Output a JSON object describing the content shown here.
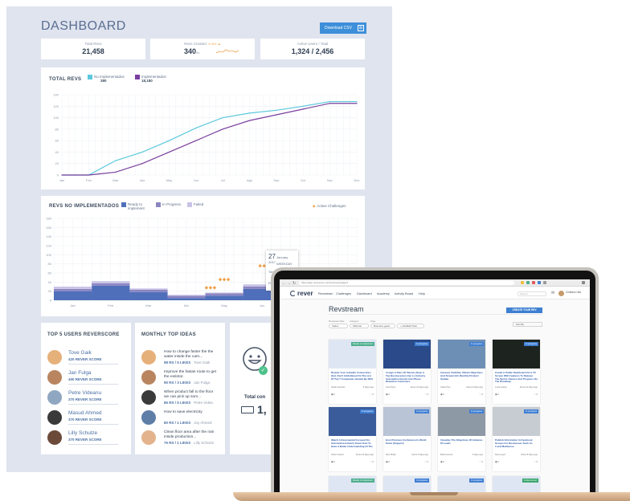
{
  "dashboard": {
    "title": "DASHBOARD",
    "download_label": "Download CSV",
    "kpis": [
      {
        "label": "Total Revs",
        "value": "21,458",
        "unit": ""
      },
      {
        "label": "Revs Created",
        "value": "340",
        "unit": "/m",
        "change": "+0.5%"
      },
      {
        "label": "Active Users / Total",
        "value": "1,324 / 2,456",
        "unit": ""
      }
    ],
    "total_revs": {
      "title": "TOTAL REVS",
      "legend": [
        {
          "label": "No Implementados",
          "value": "380",
          "color": "#5cc8dc"
        },
        {
          "label": "Implementados",
          "value": "18,180",
          "color": "#7a3f9e"
        }
      ]
    },
    "revs_no_impl": {
      "title": "REVS NO IMPLEMENTADOS",
      "legend": [
        {
          "label": "Ready to implement",
          "color": "#4f6fba"
        },
        {
          "label": "In Progress",
          "color": "#8b85c2"
        },
        {
          "label": "Failed",
          "color": "#c9c3e6"
        }
      ],
      "challenge_label": "Active Challenges",
      "tooltip": {
        "date": "27",
        "date_label": "January 2017",
        "weekday": "WEEKDAY",
        "rows": [
          {
            "label": "Total",
            "value": "120"
          },
          {
            "label": "Ready"
          },
          {
            "label": "In Pr"
          }
        ]
      }
    },
    "top_users": {
      "title": "TOP 5 USERS REVERSCORE",
      "users": [
        {
          "name": "Tove Gaik",
          "score": "420 REVER SCORE",
          "avatar_color": "#e6b07a"
        },
        {
          "name": "Jan Fulga",
          "score": "400 REVER SCORE",
          "avatar_color": "#b98560"
        },
        {
          "name": "Petre Videanu",
          "score": "370 REVER SCORE",
          "avatar_color": "#8fa7c0"
        },
        {
          "name": "Masud Ahmed",
          "score": "370 REVER SCORE",
          "avatar_color": "#3a3a3a"
        },
        {
          "name": "Lilly Schulze",
          "score": "370 REVER SCORE",
          "avatar_color": "#6b4a3a"
        }
      ]
    },
    "top_ideas": {
      "title": "MONTHLY TOP IDEAS",
      "ideas": [
        {
          "text": "How to change faster the the water inside the cam...",
          "stats": "98 RS / 5 LIKES",
          "author": "Tove Gaik",
          "avatar_color": "#e6b07a"
        },
        {
          "text": "Improve the fastas route to get the extintor.",
          "stats": "90 RS / 3 LIKES",
          "author": "Jan Fulga",
          "avatar_color": "#b98560"
        },
        {
          "text": "When product fall to the floor we can pick up som...",
          "stats": "85 RS / 5 LIKES",
          "author": "Petre Videa",
          "avatar_color": "#3a3a3a"
        },
        {
          "text": "How to save electricity",
          "stats": "80 RS / 1 LIKES",
          "author": "Joy Ahmed",
          "avatar_color": "#5e7ea8"
        },
        {
          "text": "Clean floor area after the rain inside production...",
          "stats": "75 RS / 1 LIKES",
          "author": "Lilly Schulze",
          "avatar_color": "#e2b38c"
        }
      ]
    },
    "partial_card": {
      "label": "Total con",
      "value": "1,",
      "icon": "smiley-icon"
    }
  },
  "chart_data": [
    {
      "type": "line",
      "title": "TOTAL REVS",
      "x": [
        "Jan",
        "Feb",
        "Mar",
        "Abr",
        "May",
        "Jun",
        "Jul",
        "Ago",
        "Sep",
        "Oct",
        "Nov",
        "Dec"
      ],
      "ylim": [
        0,
        140
      ],
      "yticks": [
        0,
        20,
        40,
        60,
        80,
        100,
        120,
        140
      ],
      "grid": true,
      "series": [
        {
          "name": "No Implementados",
          "color": "#5cc8dc",
          "values": [
            0,
            0,
            25,
            40,
            60,
            82,
            100,
            108,
            113,
            120,
            128,
            128
          ]
        },
        {
          "name": "Implementados",
          "color": "#7a3f9e",
          "values": [
            0,
            0,
            5,
            20,
            40,
            60,
            80,
            95,
            105,
            115,
            125,
            125
          ]
        }
      ]
    },
    {
      "type": "area",
      "title": "REVS NO IMPLEMENTADOS",
      "x": [
        "Jan",
        "Feb",
        "Mar",
        "Abr",
        "May",
        "Jun",
        "Jul",
        "Ago"
      ],
      "ylim": [
        0,
        180
      ],
      "yticks": [
        0,
        20,
        40,
        60,
        80,
        100,
        120,
        140,
        160,
        180
      ],
      "grid": true,
      "series": [
        {
          "name": "Ready to implement",
          "color": "#4f6fba",
          "values": [
            20,
            32,
            18,
            5,
            10,
            25,
            55,
            40
          ]
        },
        {
          "name": "In Progress",
          "color": "#8b85c2",
          "values": [
            5,
            5,
            5,
            5,
            5,
            5,
            5,
            15
          ]
        },
        {
          "name": "Failed",
          "color": "#c9c3e6",
          "values": [
            5,
            5,
            3,
            2,
            2,
            5,
            5,
            10
          ]
        }
      ]
    }
  ],
  "browser": {
    "url": "https://app.reverscore.net/revstream/page/1"
  },
  "app": {
    "logo": "rever",
    "nav": [
      "Revstream",
      "Challenges",
      "Dashboard",
      "Academy",
      "Activity Board",
      "Help"
    ],
    "search_placeholder": "Search",
    "user_name": "Cristiano Ulla",
    "page_title": "Revstream",
    "create_label": "CREATE YOUR REV",
    "filter_labels": [
      "Revstream filter",
      "Category",
      "Tags"
    ],
    "filters": [
      "Status",
      "Webinar",
      "Business gears",
      "+ Add/Edit Filter"
    ],
    "sort_label": "Sort By",
    "cards": [
      {
        "badge": "Ready to implement",
        "badge_color": "#4cae8c",
        "img_color": "#dfe6f3",
        "title": "Review Your LinkedIn Connections (Get, Don't Add) Based On The List Of Top 7 Companies Hunted By SEO",
        "author": "Stefan Gerriets",
        "date": "6 Days Ago"
      },
      {
        "badge": "In progress",
        "badge_color": "#3f7fd4",
        "img_color": "#2b4a8a",
        "title": "Assign A Pairs Of Talents (Seen A Top Businessmen Can Lo Industry Automation Events Into Phone Retention Customers",
        "author": "Ana Pedro",
        "date": "About 10 Days Ago"
      },
      {
        "badge": "In progress",
        "badge_color": "#3f7fd4",
        "img_color": "#6e8fb5",
        "title": "Increase Visibility: Obtain Objectives And Stream Info Monthly Product Update",
        "author": "Claire Plus",
        "date": "About 6 Days Ago"
      },
      {
        "badge": "In progress",
        "badge_color": "#3f7fd4",
        "img_color": "#1d2420",
        "title": "Create A Public Dashboard On A TV Screen With Features To Release The Sprint, Owners And Progress On The Roadmap",
        "author": "Lucia Garcia",
        "date": "About 12 Days Ago"
      },
      {
        "badge": "In progress",
        "badge_color": "#3f7fd4",
        "img_color": "#3a5c9a",
        "title": "Watch A Documental Focused On Automotive Industry Event How To Have A Better Understanding Of The",
        "author": "Pedro Suarez",
        "date": "About 1d Days Ago"
      },
      {
        "badge": "In progress",
        "badge_color": "#3f7fd4",
        "img_color": "#b9c4d6",
        "title": "Host Previous Conference In World Event (Support)",
        "author": "Ruiz Muller",
        "date": "About 9 Days Ago"
      },
      {
        "badge": "In progress",
        "badge_color": "#3f7fd4",
        "img_color": "#8e99a6",
        "title": "Visualize The Objectives Of Advance Of Leads",
        "author": "Marta Gomez",
        "date": "3 Days Ago"
      },
      {
        "badge": "In progress",
        "badge_color": "#3f7fd4",
        "img_color": "#c7ccd3",
        "title": "Publish Information In Facebook Groups For Businesses Such As Local Multiverse",
        "author": "Raul Lopez",
        "date": "About 8 Days Ago"
      }
    ],
    "next_badges": [
      "Ready to implement",
      "In progress",
      "In progress",
      "Implemented"
    ]
  }
}
